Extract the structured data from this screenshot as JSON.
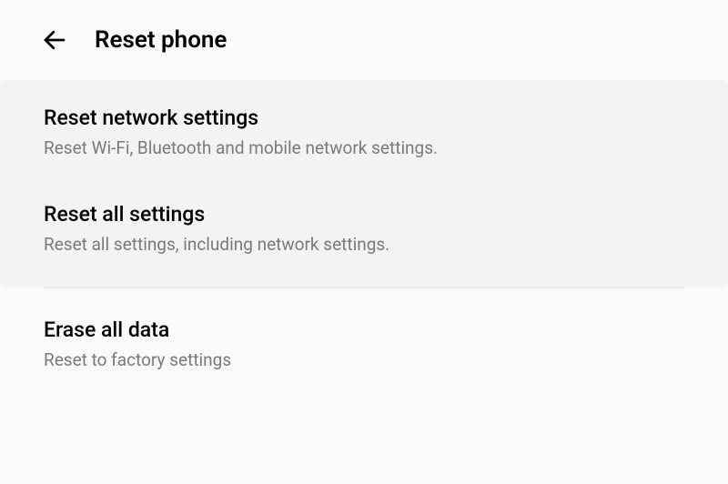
{
  "header": {
    "title": "Reset phone"
  },
  "items": [
    {
      "title": "Reset network settings",
      "subtitle": "Reset Wi-Fi, Bluetooth and mobile network settings."
    },
    {
      "title": "Reset all settings",
      "subtitle": "Reset all settings, including network settings."
    },
    {
      "title": "Erase all data",
      "subtitle": "Reset to factory settings"
    }
  ]
}
